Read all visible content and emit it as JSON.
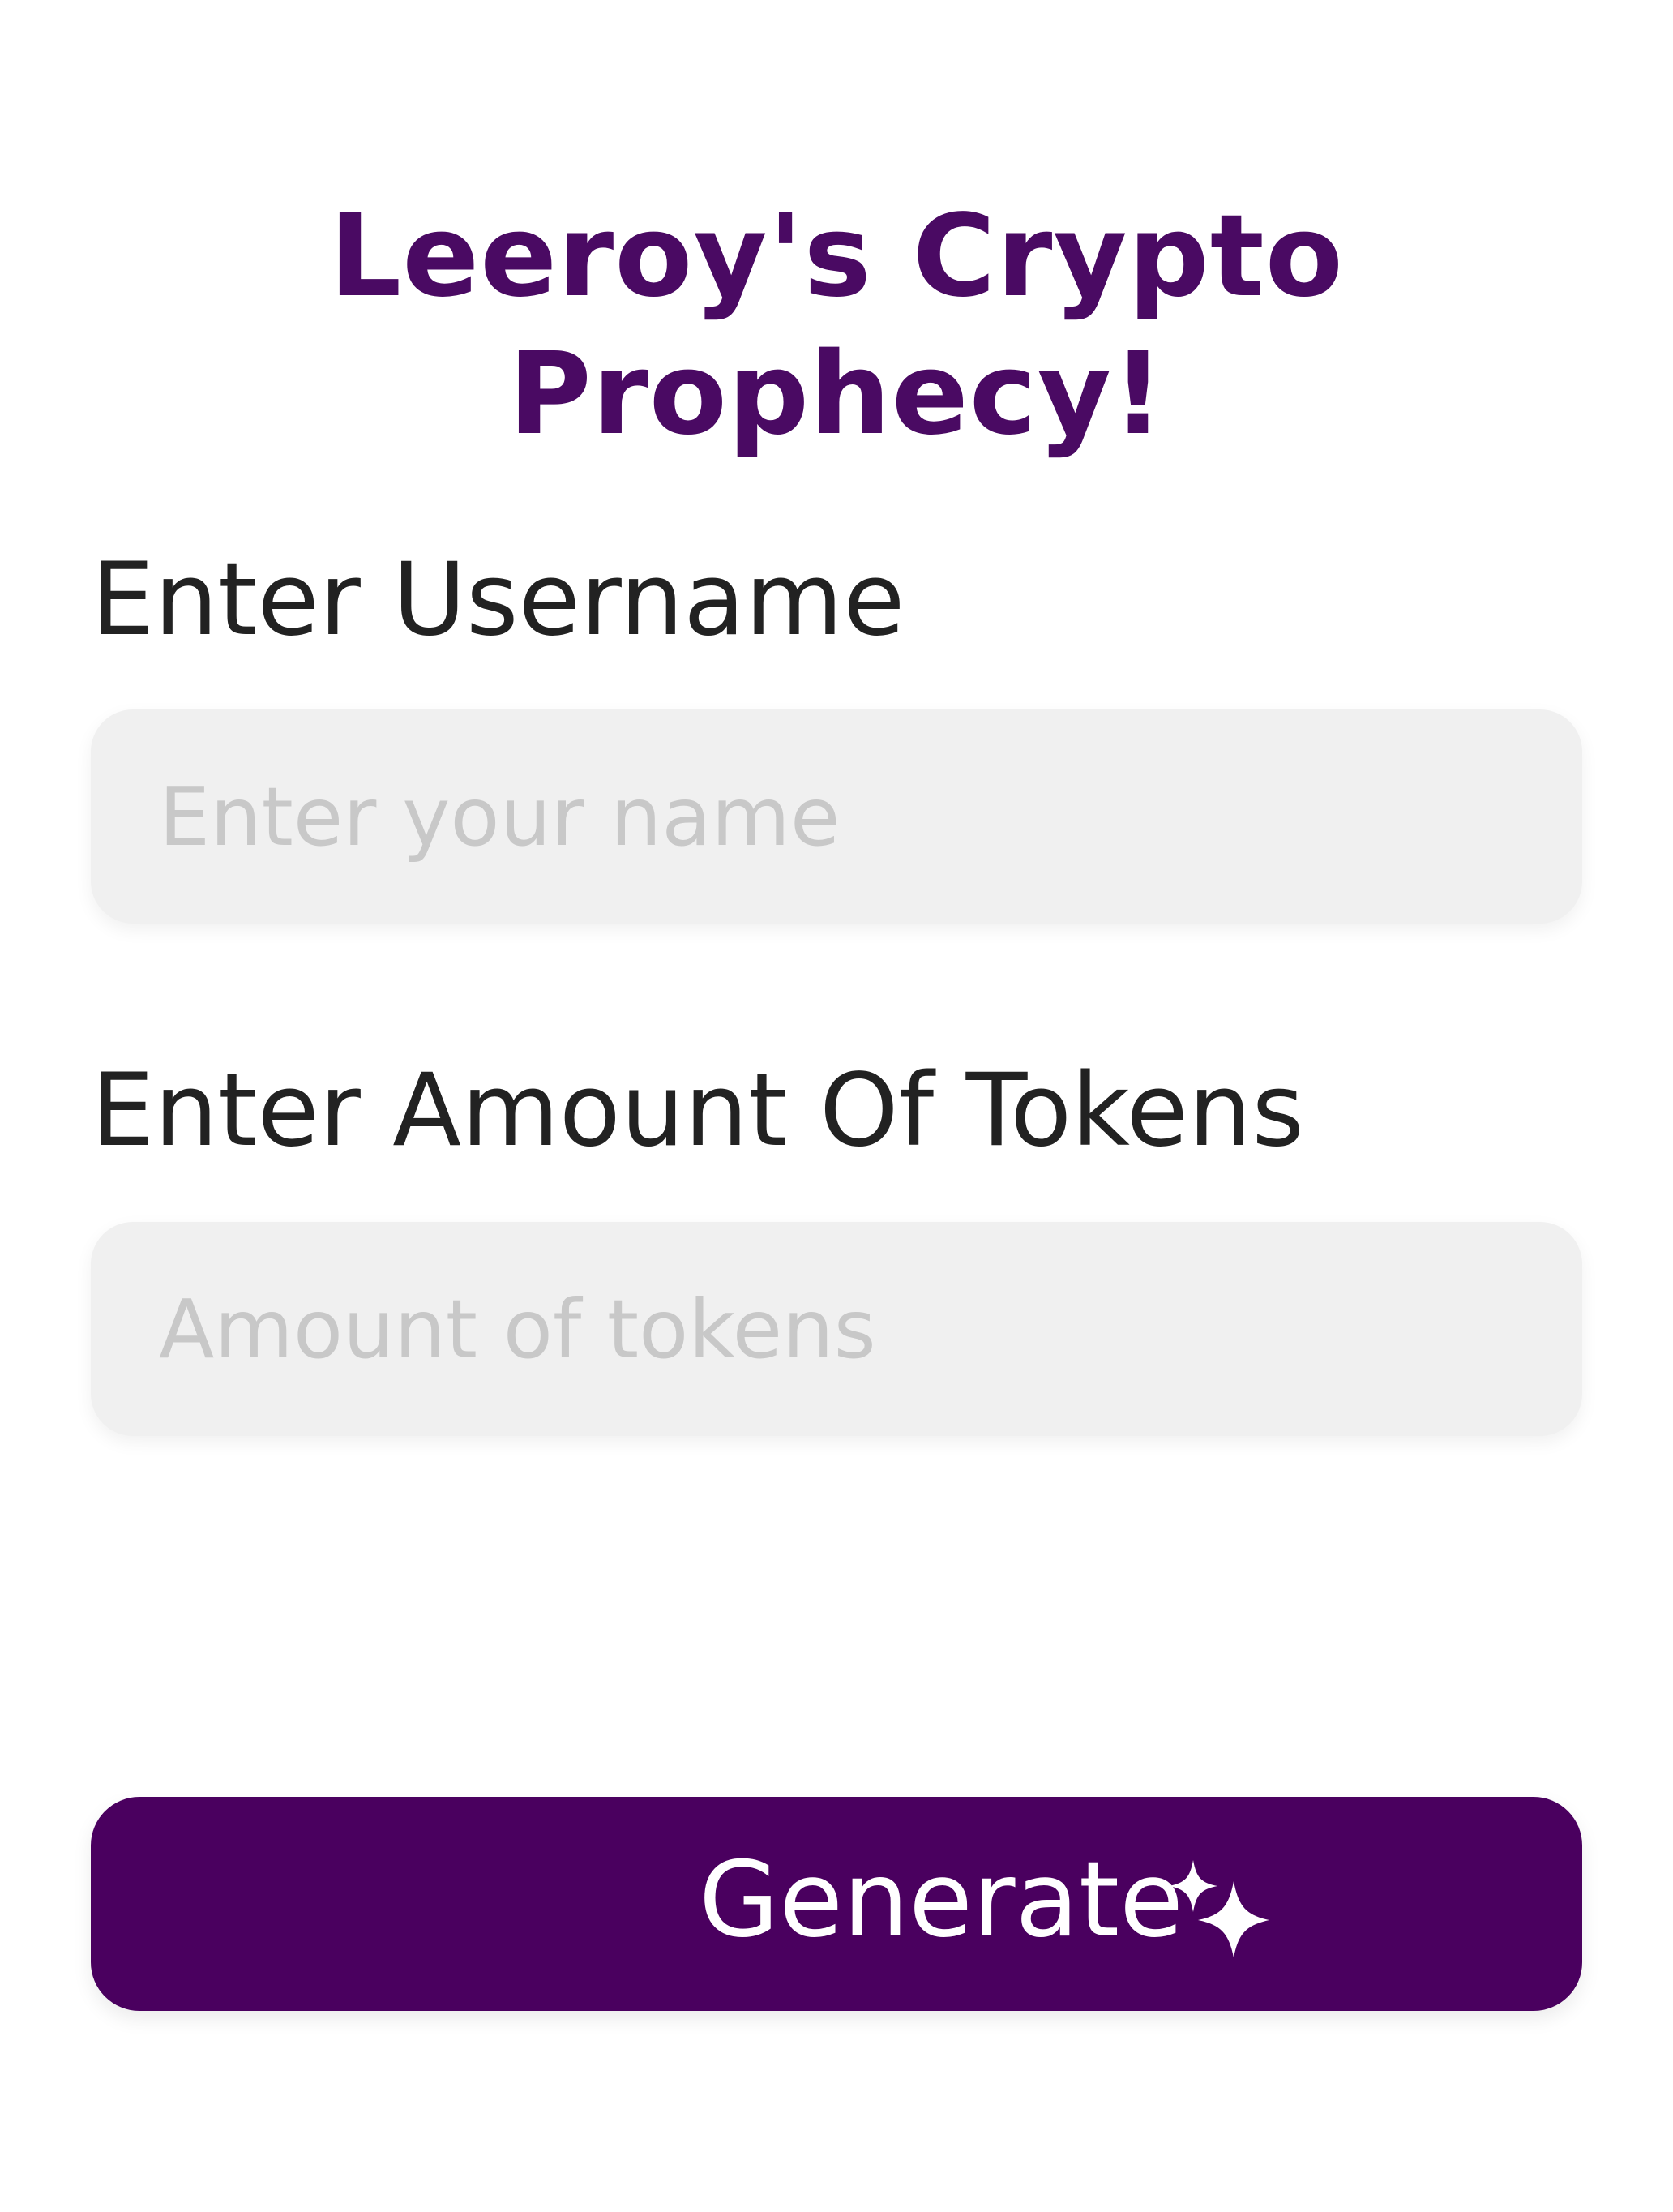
{
  "header": {
    "title": "Leeroy's Crypto Prophecy!"
  },
  "form": {
    "username": {
      "label": "Enter Username",
      "placeholder": "Enter your name",
      "value": ""
    },
    "tokens": {
      "label": "Enter Amount Of Tokens",
      "placeholder": "Amount of tokens",
      "value": ""
    },
    "submit": {
      "label": "Generate",
      "icon": "sparkle-icon"
    }
  },
  "colors": {
    "accent": "#4a005f",
    "title": "#4a0a63",
    "field_background": "#f0f0f0",
    "placeholder": "#c8c8c8",
    "label_text": "#222222",
    "button_text": "#ffffff"
  }
}
